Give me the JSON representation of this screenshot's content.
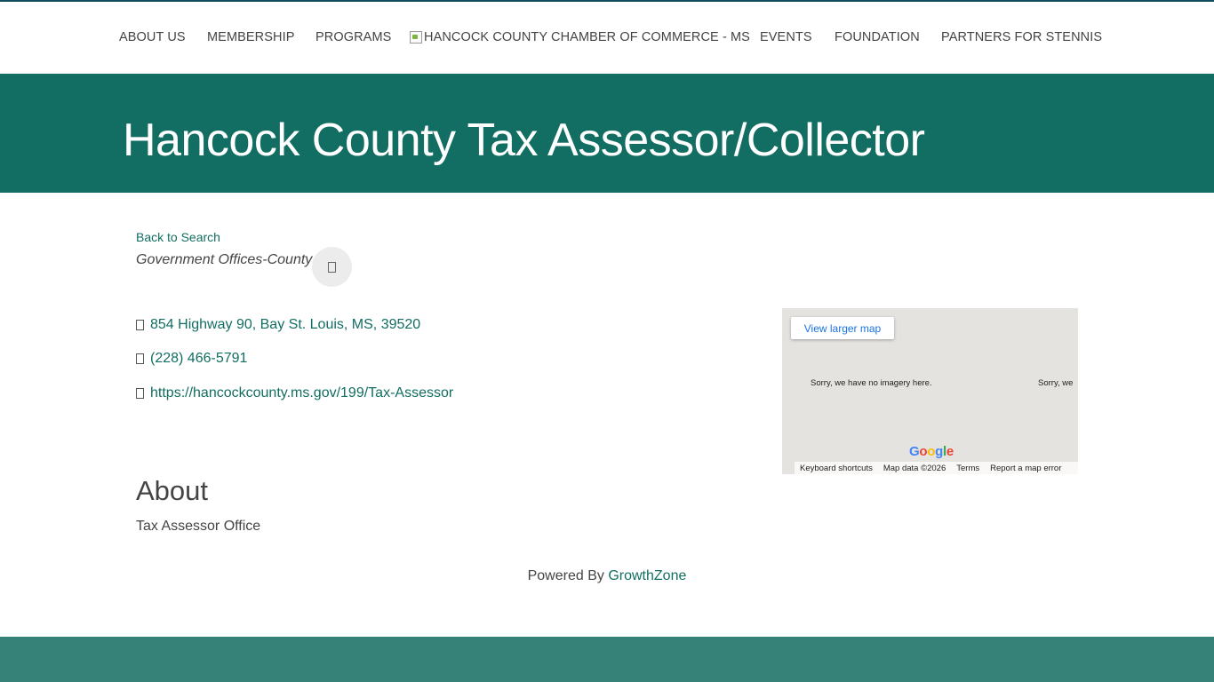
{
  "nav": {
    "items": [
      "ABOUT US",
      "MEMBERSHIP",
      "PROGRAMS",
      "EVENTS",
      "FOUNDATION",
      "PARTNERS FOR STENNIS"
    ],
    "logo_alt": "HANCOCK COUNTY CHAMBER OF COMMERCE - MS"
  },
  "page": {
    "title": "Hancock County Tax Assessor/Collector",
    "back_link": "Back to Search",
    "category": "Government Offices-County"
  },
  "contact": {
    "address": "854 Highway 90, Bay St. Louis, MS, 39520",
    "phone": "(228) 466-5791",
    "website": "https://hancockcounty.ms.gov/199/Tax-Assessor"
  },
  "map": {
    "view_larger": "View larger map",
    "no_imagery": "Sorry, we have no imagery here.",
    "no_imagery_partial": "Sorry, we",
    "logo": "Google",
    "footer": [
      "Keyboard shortcuts",
      "Map data ©2026",
      "Terms",
      "Report a map error"
    ]
  },
  "about": {
    "heading": "About",
    "text": "Tax Assessor Office"
  },
  "powered": {
    "prefix": "Powered By ",
    "link": "GrowthZone"
  },
  "colors": {
    "brand_green": "#126e62",
    "footer_green": "#378278"
  }
}
